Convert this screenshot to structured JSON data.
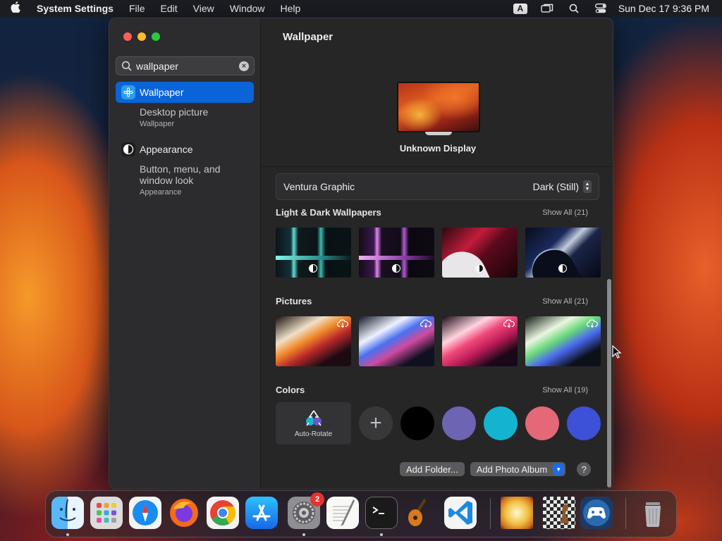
{
  "menubar": {
    "app_name": "System Settings",
    "menus": [
      "File",
      "Edit",
      "View",
      "Window",
      "Help"
    ],
    "input_source": "A",
    "clock": "Sun Dec 17  9:36 PM"
  },
  "sidebar": {
    "search_value": "wallpaper",
    "items": [
      {
        "label": "Wallpaper",
        "sub_title": "Desktop picture",
        "sub_caption": "Wallpaper"
      },
      {
        "label": "Appearance",
        "sub_title": "Button, menu, and window look",
        "sub_caption": "Appearance"
      }
    ]
  },
  "main": {
    "title": "Wallpaper",
    "display_name": "Unknown Display",
    "wallpaper_name": "Ventura Graphic",
    "appearance_mode": "Dark (Still)",
    "sections": {
      "light_dark": {
        "title": "Light & Dark Wallpapers",
        "show_all": "Show All (21)"
      },
      "pictures": {
        "title": "Pictures",
        "show_all": "Show All (21)"
      },
      "colors": {
        "title": "Colors",
        "show_all": "Show All (19)",
        "auto_rotate": "Auto-Rotate"
      }
    },
    "color_swatches": [
      "#000000",
      "#6e64b4",
      "#14b4d0",
      "#e46878",
      "#3c50d8"
    ],
    "buttons": {
      "add_folder": "Add Folder...",
      "add_photo_album": "Add Photo Album",
      "help": "?"
    }
  },
  "dock": {
    "apps": [
      "finder-icon",
      "launchpad-icon",
      "safari-icon",
      "firefox-icon",
      "chrome-icon",
      "app-store-icon",
      "system-settings-icon",
      "textedit-icon",
      "terminal-icon",
      "garageband-icon",
      "vscode-icon",
      "image-preview-icon",
      "chess-icon",
      "game-controller-icon",
      "trash-icon"
    ],
    "settings_badge": "2"
  }
}
